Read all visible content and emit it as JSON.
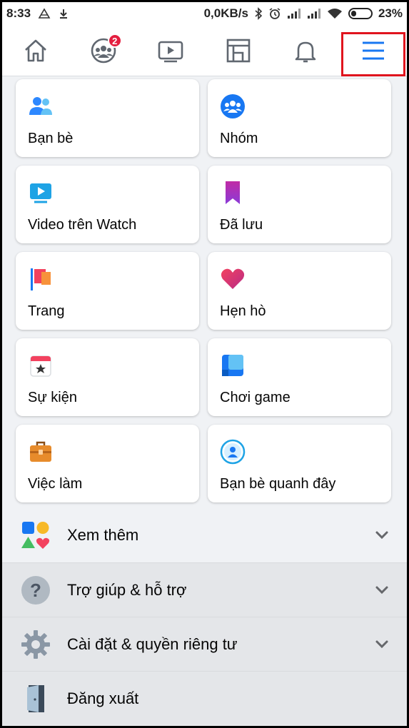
{
  "status_bar": {
    "time": "8:33",
    "speed": "0,0KB/s",
    "battery": "23%"
  },
  "top_nav": {
    "items": [
      {
        "name": "home-icon"
      },
      {
        "name": "groups-icon",
        "badge": "2"
      },
      {
        "name": "watch-icon"
      },
      {
        "name": "marketplace-icon"
      },
      {
        "name": "bell-icon"
      },
      {
        "name": "menu-icon"
      }
    ],
    "highlight_color": "#e0141e"
  },
  "shortcuts": [
    {
      "label": "Bạn bè",
      "icon": "friends-icon"
    },
    {
      "label": "Nhóm",
      "icon": "groups-icon"
    },
    {
      "label": "Video trên Watch",
      "icon": "watch-video-icon"
    },
    {
      "label": "Đã lưu",
      "icon": "saved-bookmark-icon"
    },
    {
      "label": "Trang",
      "icon": "pages-flag-icon"
    },
    {
      "label": "Hẹn hò",
      "icon": "dating-heart-icon"
    },
    {
      "label": "Sự kiện",
      "icon": "events-calendar-icon"
    },
    {
      "label": "Chơi game",
      "icon": "gaming-icon"
    },
    {
      "label": "Việc làm",
      "icon": "jobs-briefcase-icon"
    },
    {
      "label": "Bạn bè quanh đây",
      "icon": "nearby-friends-icon"
    }
  ],
  "menu_rows": [
    {
      "label": "Xem thêm",
      "icon": "see-more-icon",
      "chevron": true
    },
    {
      "label": "Trợ giúp & hỗ trợ",
      "icon": "help-icon",
      "chevron": true
    },
    {
      "label": "Cài đặt & quyền riêng tư",
      "icon": "settings-gear-icon",
      "chevron": true
    },
    {
      "label": "Đăng xuất",
      "icon": "logout-door-icon",
      "chevron": false
    }
  ],
  "colors": {
    "accent": "#1877f2",
    "background": "#f0f2f5",
    "badge": "#e41e3f"
  }
}
